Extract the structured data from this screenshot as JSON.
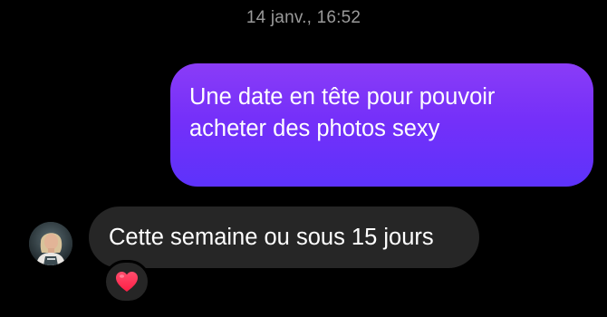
{
  "thread": {
    "timestamp": "14 janv., 16:52"
  },
  "messages": {
    "sent": {
      "text": "Une date en tête pour pouvoir acheter des photos sexy",
      "bubble_color": "#7530f9"
    },
    "received": {
      "text": "Cette semaine ou sous 15 jours",
      "bubble_color": "#262626",
      "reaction": {
        "icon": "heart-icon",
        "color": "#ff2d4f"
      }
    }
  }
}
